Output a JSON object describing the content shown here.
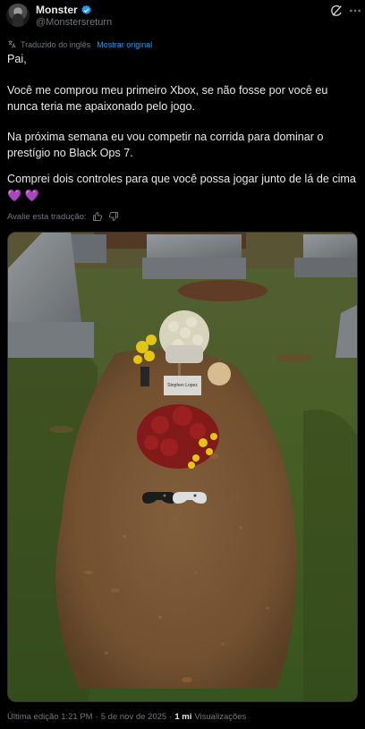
{
  "author": {
    "name": "Monster",
    "handle": "@Monstersreturn",
    "verified_color": "#1d9bf0"
  },
  "translation": {
    "notice": "Traduzido do inglês",
    "show_original": "Mostrar original",
    "rate_prompt": "Avalie esta tradução:"
  },
  "post": {
    "p1": "Pai,",
    "p2": "Você me comprou meu primeiro Xbox, se não fosse por você eu nunca teria me apaixonado pelo jogo.",
    "p3": "Na próxima semana eu vou competir na corrida para dominar o prestígio no Black Ops 7.",
    "p4": "Comprei dois controles para que você possa jogar junto de lá de cima",
    "emoji": "💜",
    "emoji_color": "#b18af7"
  },
  "media": {
    "headstone_text": "Stephen Lopez"
  },
  "footer": {
    "edited": "Última edição 1:21 PM",
    "sep": "·",
    "date": "5 de nov de 2025",
    "views_count": "1 mi",
    "views_label": "Visualizações"
  },
  "icons": {
    "verified": "verified-badge-icon",
    "grok": "grok-icon",
    "more": "more-icon",
    "translate": "translate-icon",
    "thumbs_up": "thumbs-up-icon",
    "thumbs_down": "thumbs-down-icon"
  },
  "colors": {
    "background": "#000000",
    "text": "#e7e9ea",
    "muted": "#71767b",
    "link": "#1d9bf0"
  }
}
